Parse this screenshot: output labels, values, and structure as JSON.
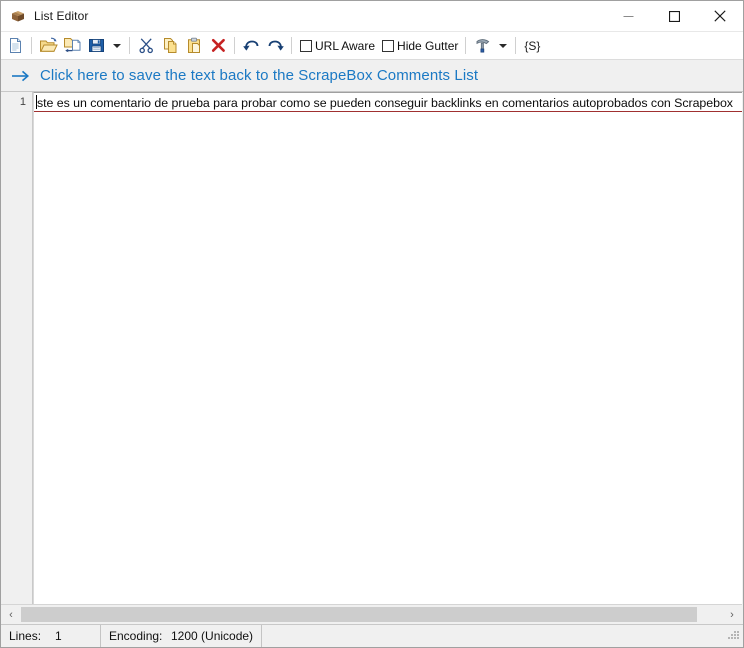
{
  "window": {
    "title": "List Editor",
    "icon": "box-icon",
    "controls": {
      "minimize": "minimize-button",
      "maximize": "maximize-button",
      "close": "close-button"
    }
  },
  "toolbar": {
    "new_label": "New",
    "open_label": "Open",
    "import_label": "Import",
    "save_label": "Save",
    "save_dropdown_label": "Save options",
    "cut_label": "Cut",
    "copy_label": "Copy",
    "paste_label": "Paste",
    "delete_label": "Delete",
    "undo_label": "Undo",
    "redo_label": "Redo",
    "url_aware_label": "URL Aware",
    "url_aware_checked": false,
    "hide_gutter_label": "Hide Gutter",
    "hide_gutter_checked": false,
    "tools_label": "Tools",
    "tools_dropdown_label": "Tools options",
    "spintax_label": "{S}"
  },
  "banner": {
    "arrow": "arrow-right-icon",
    "text": "Click here to save the text back to the ScrapeBox Comments List"
  },
  "editor": {
    "gutter": {
      "line_numbers": [
        "1"
      ]
    },
    "lines": [
      "ste es un comentario de prueba para probar como se pueden conseguir backlinks en comentarios autoprobados con Scrapebox"
    ]
  },
  "scrollbar": {
    "left_arrow": "‹",
    "right_arrow": "›",
    "thumb_label": "horizontal-scroll-thumb"
  },
  "statusbar": {
    "lines_label": "Lines:",
    "lines_value": "1",
    "encoding_label": "Encoding:",
    "encoding_value": "1200  (Unicode)"
  },
  "colors": {
    "link": "#1b79c4",
    "chrome": "#f0f0f0",
    "active_line_underline": "#a03030",
    "editor_bg": "#ffffff"
  }
}
